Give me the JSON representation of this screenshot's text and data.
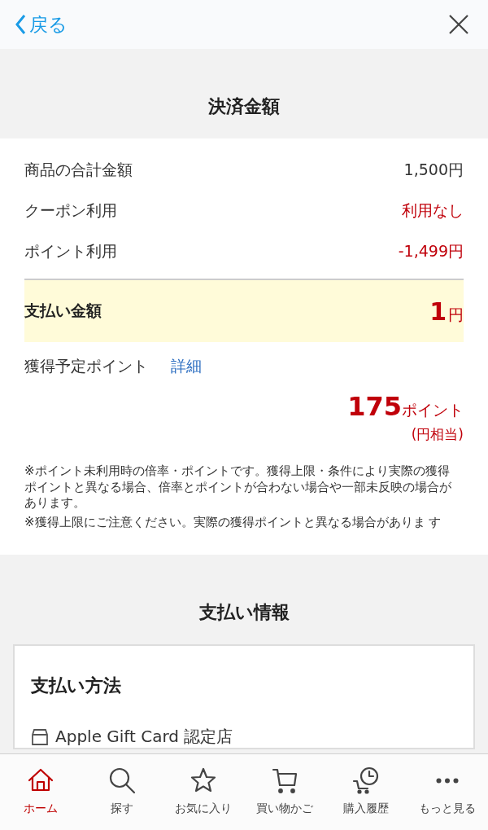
{
  "header": {
    "back_label": "戻る"
  },
  "summary": {
    "title": "決済金額",
    "rows": [
      {
        "label": "商品の合計金額",
        "value": "1,500円",
        "highlight": false
      },
      {
        "label": "クーポン利用",
        "value": "利用なし",
        "highlight": true
      },
      {
        "label": "ポイント利用",
        "value": "-1,499円",
        "highlight": true
      }
    ],
    "total": {
      "label": "支払い金額",
      "amount": "1",
      "unit": "円"
    },
    "points": {
      "label": "獲得予定ポイント",
      "link": "詳細",
      "amount": "175",
      "unit": "ポイント",
      "note": "(円相当)"
    },
    "notes": [
      "※ポイント未利用時の倍率・ポイントです。獲得上限・条件により実際の獲得ポイントと異なる場合、倍率とポイントが合わない場合や一部未反映の場合があります。",
      "※獲得上限にご注意ください。実際の獲得ポイントと異なる場合がありま す"
    ]
  },
  "payment": {
    "title": "支払い情報",
    "method_title": "支払い方法",
    "method": "Apple Gift Card 認定店"
  },
  "tabs": [
    {
      "kind": "home",
      "label": "ホーム",
      "selected": true
    },
    {
      "kind": "search",
      "label": "探す",
      "selected": false
    },
    {
      "kind": "star",
      "label": "お気に入り",
      "selected": false
    },
    {
      "kind": "cart",
      "label": "買い物かご",
      "selected": false
    },
    {
      "kind": "history",
      "label": "購入履歴",
      "selected": false
    },
    {
      "kind": "more",
      "label": "もっと見る",
      "selected": false
    }
  ]
}
